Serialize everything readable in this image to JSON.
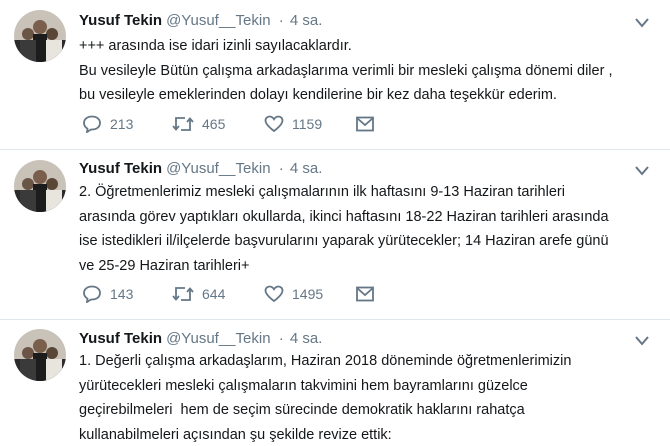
{
  "tweets": [
    {
      "name": "Yusuf Tekin",
      "handle": "@Yusuf__Tekin",
      "separator": "·",
      "time": "4 sa.",
      "lines": [
        "+++ arasında ise idari izinli sayılacaklardır.",
        "Bu vesileyle Bütün çalışma arkadaşlarıma verimli bir mesleki çalışma dönemi diler ,",
        "bu vesileyle emeklerinden dolayı kendilerine bir kez daha teşekkür ederim."
      ],
      "replies": "213",
      "retweets": "465",
      "likes": "1159"
    },
    {
      "name": "Yusuf Tekin",
      "handle": "@Yusuf__Tekin",
      "separator": "·",
      "time": "4 sa.",
      "lines": [
        "2. Öğretmenlerimiz mesleki çalışmalarının ilk haftasını 9-13 Haziran tarihleri",
        "arasında görev yaptıkları okullarda, ikinci haftasını 18-22 Haziran tarihleri arasında",
        "ise istedikleri il/ilçelerde başvurularını yaparak yürütecekler; 14 Haziran arefe günü",
        "ve 25-29 Haziran tarihleri+"
      ],
      "replies": "143",
      "retweets": "644",
      "likes": "1495"
    },
    {
      "name": "Yusuf Tekin",
      "handle": "@Yusuf__Tekin",
      "separator": "·",
      "time": "4 sa.",
      "lines": [
        "1. Değerli çalışma arkadaşlarım, Haziran 2018 döneminde öğretmenlerimizin",
        "yürütecekleri mesleki çalışmaların takvimini hem bayramlarını güzelce",
        "geçirebilmeleri  hem de seçim sürecinde demokratik haklarını rahatça",
        "kullanabilmeleri açısından şu şekilde revize ettik:"
      ]
    }
  ],
  "icons": {
    "reply": "reply-icon",
    "retweet": "retweet-icon",
    "like": "heart-icon",
    "dm": "envelope-icon",
    "more": "chevron-down-icon"
  },
  "colors": {
    "text": "#14171a",
    "secondary": "#657786",
    "border": "#e1e8ed"
  }
}
